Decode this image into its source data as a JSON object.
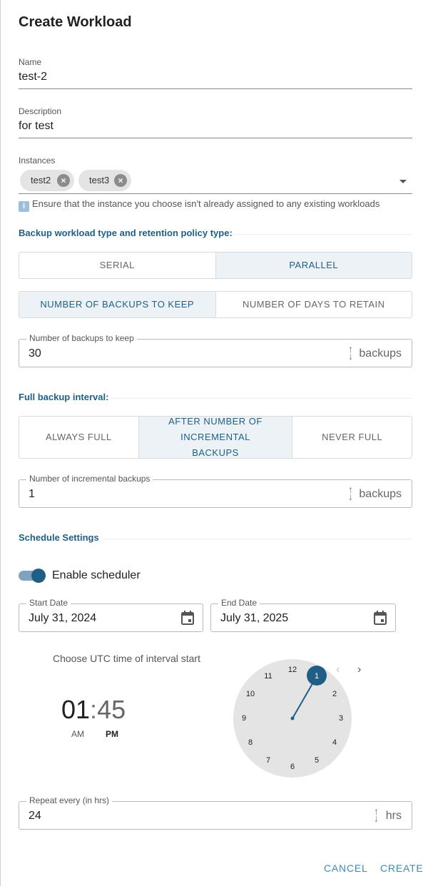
{
  "dialog": {
    "title": "Create Workload"
  },
  "name": {
    "label": "Name",
    "value": "test-2"
  },
  "description": {
    "label": "Description",
    "value": "for test"
  },
  "instances": {
    "label": "Instances",
    "chips": [
      "test2",
      "test3"
    ],
    "hint": "Ensure that the instance you choose isn't already assigned to any existing workloads"
  },
  "retention": {
    "section_title": "Backup workload type and retention policy type:",
    "type_options": [
      "SERIAL",
      "PARALLEL"
    ],
    "type_selected": "PARALLEL",
    "policy_options": [
      "NUMBER OF BACKUPS TO KEEP",
      "NUMBER OF DAYS TO RETAIN"
    ],
    "policy_selected": "NUMBER OF BACKUPS TO KEEP",
    "backups_label": "Number of backups to keep",
    "backups_value": "30",
    "backups_unit": "backups"
  },
  "full_backup": {
    "section_title": "Full backup interval:",
    "options": [
      "ALWAYS FULL",
      "AFTER NUMBER OF INCREMENTAL BACKUPS",
      "NEVER FULL"
    ],
    "selected": "AFTER NUMBER OF INCREMENTAL BACKUPS",
    "incremental_label": "Number of incremental backups",
    "incremental_value": "1",
    "incremental_unit": "backups"
  },
  "schedule": {
    "section_title": "Schedule Settings",
    "enable_label": "Enable scheduler",
    "enabled": true,
    "start_date_label": "Start Date",
    "start_date": "July 31, 2024",
    "end_date_label": "End Date",
    "end_date": "July 31, 2025",
    "utc_label": "Choose UTC time of interval start",
    "hours": "01",
    "separator": ":",
    "minutes": "45",
    "am": "AM",
    "pm": "PM",
    "period_selected": "PM",
    "clock_numbers": [
      "12",
      "1",
      "2",
      "3",
      "4",
      "5",
      "6",
      "7",
      "8",
      "9",
      "10",
      "11"
    ],
    "clock_selected": "1",
    "repeat_label": "Repeat every (in hrs)",
    "repeat_value": "24",
    "repeat_unit": "hrs"
  },
  "actions": {
    "cancel": "CANCEL",
    "create": "CREATE"
  },
  "colors": {
    "accent": "#1f5f86",
    "link": "#3d88bb",
    "selected_bg": "#edf2f6"
  }
}
